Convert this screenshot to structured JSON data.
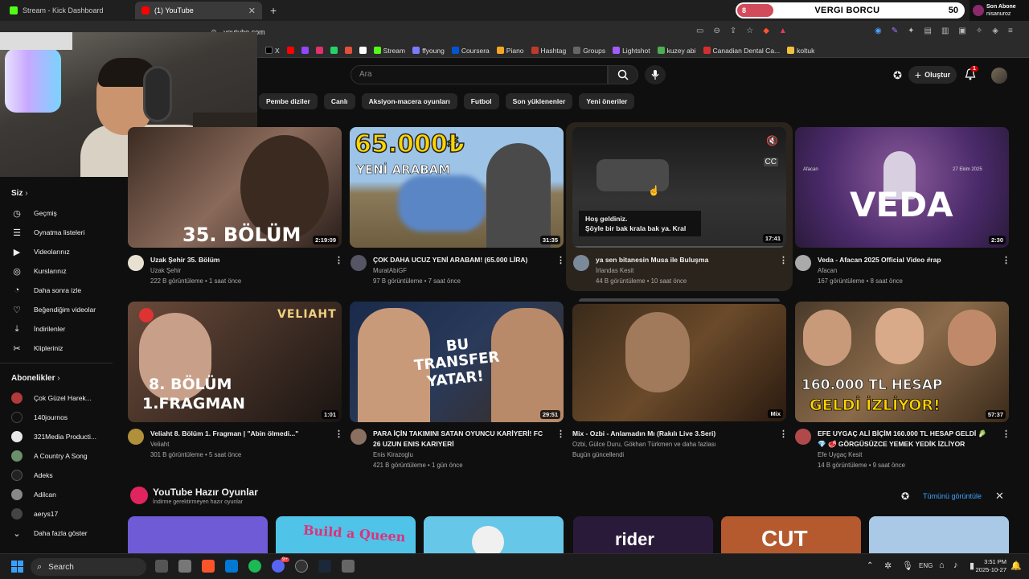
{
  "browser": {
    "tabs": [
      {
        "label": "Stream - Kick Dashboard",
        "active": false
      },
      {
        "label": "(1) YouTube",
        "active": true
      }
    ],
    "url": "youtube.com",
    "bookmarks": [
      "X",
      "Stream",
      "ffyoung",
      "Coursera",
      "Piano",
      "Hashtag",
      "Groups",
      "Lightshot",
      "kuzey abi",
      "Canadian Dental Ca...",
      "koltuk"
    ]
  },
  "overlay": {
    "tax_left": "8",
    "tax_title": "VERGI BORCU",
    "tax_right": "50",
    "tax_progress": 0.16,
    "sub_label": "Son Abone",
    "sub_name": "nisanuroz"
  },
  "header": {
    "search_placeholder": "Ara",
    "create_label": "Oluştur",
    "notification_count": "1"
  },
  "chips": [
    "Pembe diziler",
    "Canlı",
    "Aksiyon-macera oyunları",
    "Futbol",
    "Son yüklenenler",
    "Yeni öneriler"
  ],
  "sidebar": {
    "you_label": "Siz",
    "items": [
      {
        "label": "Geçmiş",
        "icon": "history-icon"
      },
      {
        "label": "Oynatma listeleri",
        "icon": "playlist-icon"
      },
      {
        "label": "Videolarınız",
        "icon": "your-videos-icon"
      },
      {
        "label": "Kurslarınız",
        "icon": "courses-icon"
      },
      {
        "label": "Daha sonra izle",
        "icon": "watch-later-icon"
      },
      {
        "label": "Beğendiğim videolar",
        "icon": "like-icon"
      },
      {
        "label": "İndirilenler",
        "icon": "download-icon"
      },
      {
        "label": "Klipleriniz",
        "icon": "scissors-icon"
      }
    ],
    "subs_label": "Abonelikler",
    "subs": [
      {
        "label": "Çok Güzel Harek...",
        "color": "#b33a3a"
      },
      {
        "label": "140journos",
        "color": "#111111"
      },
      {
        "label": "321Media Producti...",
        "color": "#e8e8e8"
      },
      {
        "label": "A Country A Song",
        "color": "#6b8f6b"
      },
      {
        "label": "Adeks",
        "color": "#222222"
      },
      {
        "label": "Adilcan",
        "color": "#888888"
      },
      {
        "label": "aerys17",
        "color": "#444444"
      }
    ],
    "show_more": "Daha fazla göster"
  },
  "videos": [
    {
      "title": "Uzak Şehir 35. Bölüm",
      "channel": "Uzak Şehir",
      "meta": "222 B görüntüleme • 1 saat önce",
      "duration": "2:19:09",
      "overlay": "35. BÖLÜM"
    },
    {
      "title": "ÇOK DAHA UCUZ YENİ ARABAM! (65.000 LİRA)",
      "channel": "MuratAbiGF",
      "meta": "97 B görüntüleme • 7 saat önce",
      "duration": "31:35",
      "overlay": "65.000₺",
      "overlay2": "YENİ ARABAM"
    },
    {
      "title": "ya sen bitanesin Musa ile Buluşma",
      "channel": "İrlandas Kesit",
      "meta": "44 B görüntüleme • 10 saat önce",
      "duration": "17:41",
      "overlay": "Hoş geldiniz.",
      "overlay2": "Şöyle bir bak krala bak ya. Kral"
    },
    {
      "title": "Veda - Afacan 2025 Official Video #rap",
      "channel": "Afacan",
      "meta": "167 görüntüleme • 8 saat önce",
      "duration": "2:30",
      "overlay": "VEDA",
      "overlay_small_l": "Afacan",
      "overlay_small_r": "27 Ekim 2025"
    },
    {
      "title": "Veliaht 8. Bölüm 1. Fragman | \"Abin ölmedi...\"",
      "channel": "Veliaht",
      "meta": "301 B görüntüleme • 5 saat önce",
      "duration": "1:01",
      "overlay": "8. BÖLÜM",
      "overlay2": "1.FRAGMAN",
      "overlay3": "VELIAHT"
    },
    {
      "title": "PARA İÇİN TAKIMINI SATAN OYUNCU KARİYERİ! FC",
      "title2": "26 UZUN ENIS KARIYERİ",
      "channel": "Enis Kirazoglu",
      "meta": "421 B görüntüleme • 1 gün önce",
      "duration": "29:51",
      "overlay": "BU",
      "overlay2": "TRANSFER",
      "overlay3": "YATAR!"
    },
    {
      "title": "Mix - Ozbi - Anlamadın Mı (Rakılı Live 3.Seri)",
      "channel": "Ozbi, Gülce Duru, Gökhan Türkmen ve daha fazlası",
      "meta": "Bugün güncellendi",
      "duration": "Mix"
    },
    {
      "title": "EFE UYGAÇ ALİ BİÇİM 160.000 TL HESAP GELDİ 🥬",
      "title2": "💎 🥩 GÖRGÜSÜZCE YEMEK YEDİK İZLİYOR",
      "channel": "Efe Uygaç Kesit",
      "meta": "14 B görüntüleme • 9 saat önce",
      "duration": "57:37",
      "overlay": "160.000 TL HESAP",
      "overlay2": "GELDİ İZLİYOR!"
    }
  ],
  "games": {
    "title": "YouTube Hazır Oyunlar",
    "subtitle": "İndirme gerektirmeyen hazır oyunlar",
    "see_all": "Tümünü görüntüle",
    "items": [
      {
        "label": "",
        "color": "#6f5bd6"
      },
      {
        "label": "Build a Queen",
        "color": "#4fc4e8"
      },
      {
        "label": "",
        "color": "#67c7e8"
      },
      {
        "label": "rider",
        "color": "#2a1a3a"
      },
      {
        "label": "CUT",
        "color": "#b45a2e"
      },
      {
        "label": "",
        "color": "#a9c9e6"
      }
    ]
  },
  "taskbar": {
    "search_label": "Search",
    "lang": "ENG",
    "time": "3:51 PM",
    "date": "2025-10-27",
    "discord_badge": "9+"
  }
}
